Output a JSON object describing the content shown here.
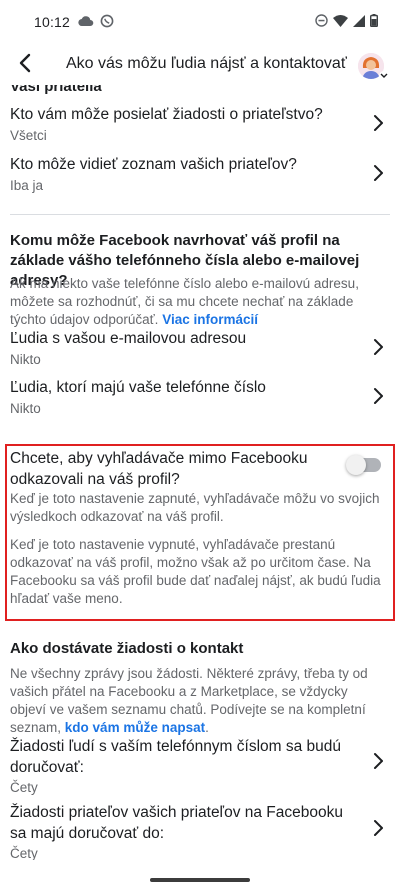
{
  "status_bar": {
    "time": "10:12",
    "icons_left": [
      "cloud-icon",
      "viber-icon"
    ],
    "icons_right": [
      "do-not-disturb-icon",
      "wifi-icon",
      "signal-icon",
      "battery-icon"
    ]
  },
  "header": {
    "title": "Ako vás môžu ľudia nájsť a kontaktovať",
    "back_icon": "back-arrow-icon",
    "avatar_icon": "profile-avatar-icon"
  },
  "partial_heading": "Vaši priatelia",
  "friends_rows": [
    {
      "title": "Kto vám môže posielať žiadosti o priateľstvo?",
      "value": "Všetci"
    },
    {
      "title": "Kto môže vidieť zoznam vašich priateľov?",
      "value": "Iba ja"
    }
  ],
  "lookup_section": {
    "heading": "Komu môže Facebook navrhovať váš profil na základe vášho telefónneho čísla alebo e-mailovej adresy?",
    "description": "Ak má niekto vaše telefónne číslo alebo e-mailovú adresu, môžete sa rozhodnúť, či sa mu chcete nechať na základe týchto údajov odporúčať.",
    "link": "Viac informácií",
    "rows": [
      {
        "title": "Ľudia s vašou e-mailovou adresou",
        "value": "Nikto"
      },
      {
        "title": "Ľudia, ktorí majú vaše telefónne číslo",
        "value": "Nikto"
      }
    ]
  },
  "search_engines": {
    "title": "Chcete, aby vyhľadávače mimo Facebooku odkazovali na váš profil?",
    "toggle_on": false,
    "desc_on": "Keď je toto nastavenie zapnuté, vyhľadávače môžu vo svojich výsledkoch odkazovať na váš profil.",
    "desc_off": "Keď je toto nastavenie vypnuté, vyhľadávače prestanú odkazovať na váš profil, možno však až po určitom čase. Na Facebooku sa váš profil bude dať naďalej nájsť, ak budú ľudia hľadať vaše meno."
  },
  "contact_requests": {
    "heading": "Ako dostávate žiadosti o kontakt",
    "description": "Ne všechny zprávy jsou žádosti. Některé zprávy, třeba ty od vašich přátel na Facebooku a z Marketplace, se vždycky objeví ve vašem seznamu chatů. Podívejte se na kompletní seznam,",
    "link": "kdo vám může napsat",
    "link_suffix": ".",
    "rows": [
      {
        "title": "Žiadosti ľudí s vaším telefónnym číslom sa budú doručovať:",
        "value": "Čety"
      },
      {
        "title": "Žiadosti priateľov vašich priateľov na Facebooku sa majú doručovať do:",
        "value": "Čety"
      }
    ]
  },
  "colors": {
    "text_primary": "#1c1e21",
    "text_secondary": "#65676b",
    "link": "#1b74e4",
    "highlight_border": "#e02020",
    "divider": "#dadde1"
  }
}
